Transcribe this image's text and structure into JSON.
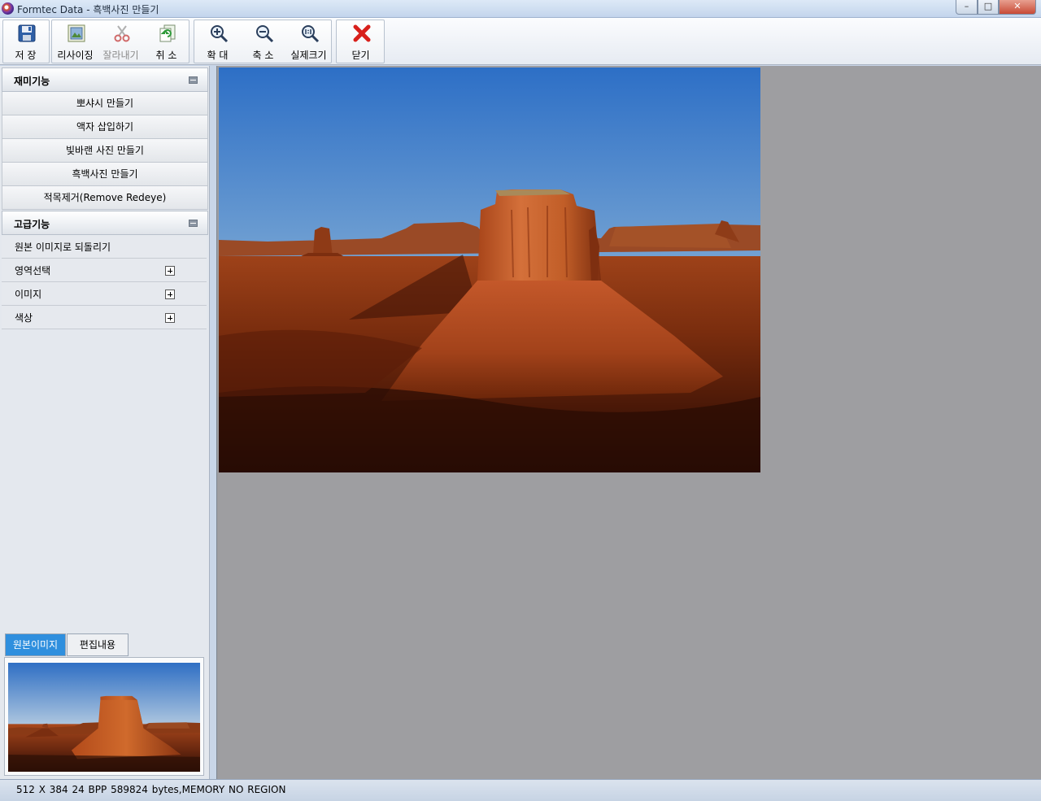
{
  "window": {
    "title": "Formtec Data - 흑백사진 만들기",
    "minimize": "–",
    "maximize": "□",
    "close": "✕"
  },
  "toolbar": {
    "save": "저 장",
    "resize": "리사이징",
    "cut": "잘라내기",
    "undo": "취 소",
    "zoom_in": "확 대",
    "zoom_out": "축 소",
    "actual_size": "실제크기",
    "close": "닫기"
  },
  "sidebar": {
    "fun_section": {
      "title": "재미기능",
      "items": [
        "뽀샤시 만들기",
        "액자 삽입하기",
        "빛바랜 사진 만들기",
        "흑백사진 만들기",
        "적목제거(Remove Redeye)"
      ]
    },
    "advanced_section": {
      "title": "고급기능",
      "items": [
        "원본 이미지로 되돌리기",
        "영역선택",
        "이미지",
        "색상"
      ]
    },
    "tabs": [
      "원본이미지",
      "편집내용"
    ],
    "active_tab": "원본이미지"
  },
  "status": {
    "text": "512 X 384   24 BPP   589824 bytes,MEMORY   NO REGION"
  },
  "colors": {
    "active_tab": "#2f8fde",
    "canvas_bg": "#9e9ea1",
    "close_icon": "#d8201b"
  }
}
